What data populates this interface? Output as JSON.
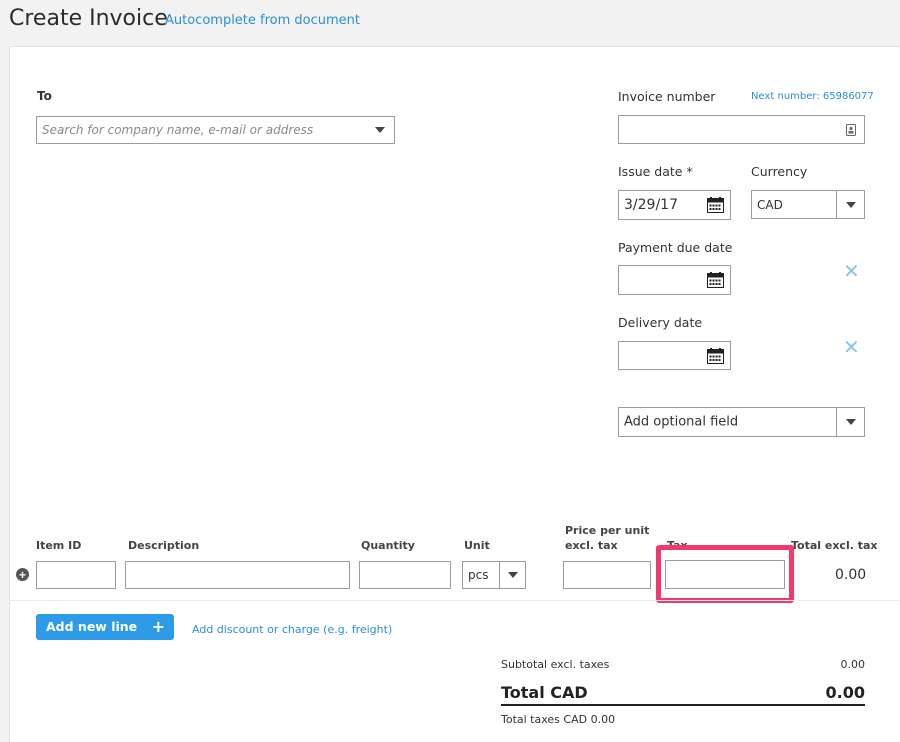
{
  "header": {
    "title": "Create Invoice",
    "autocomplete_link": "Autocomplete from document"
  },
  "recipient": {
    "label": "To",
    "search_placeholder": "Search for company name, e-mail or address"
  },
  "invoice_number": {
    "label": "Invoice number",
    "next_number_link": "Next number: 65986077",
    "value": ""
  },
  "issue_date": {
    "label": "Issue date *",
    "value": "3/29/17"
  },
  "currency": {
    "label": "Currency",
    "value": "CAD"
  },
  "payment_due_date": {
    "label": "Payment due date",
    "value": ""
  },
  "delivery_date": {
    "label": "Delivery date",
    "value": ""
  },
  "optional_field": {
    "value": "Add optional field"
  },
  "line_items": {
    "columns": {
      "item_id": "Item ID",
      "description": "Description",
      "quantity": "Quantity",
      "unit": "Unit",
      "price_line1": "Price per unit",
      "price_line2": "excl. tax",
      "tax": "Tax",
      "total": "Total excl. tax"
    },
    "rows": [
      {
        "item_id": "",
        "description": "",
        "quantity": "",
        "unit": "pcs",
        "price": "",
        "tax": "",
        "total": "0.00"
      }
    ]
  },
  "actions": {
    "add_line": "Add new line",
    "add_discount": "Add discount or charge (e.g. freight)"
  },
  "summary": {
    "subtotal_label": "Subtotal excl. taxes",
    "subtotal_value": "0.00",
    "total_label": "Total CAD",
    "total_value": "0.00",
    "taxes_label": "Total taxes CAD 0.00"
  },
  "colors": {
    "accent": "#2d9be8",
    "link": "#2a8fd6",
    "highlight": "#f0396f"
  },
  "icons": [
    "calendar-icon",
    "address-book-icon",
    "chevron-down-icon",
    "close-icon",
    "plus-icon"
  ]
}
